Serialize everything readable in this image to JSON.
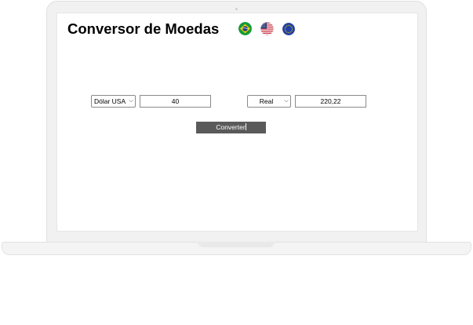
{
  "app": {
    "title": "Conversor de Moedas"
  },
  "flags": [
    {
      "name": "brazil-flag-icon",
      "country": "Brasil"
    },
    {
      "name": "usa-flag-icon",
      "country": "USA"
    },
    {
      "name": "eu-flag-icon",
      "country": "Euro"
    }
  ],
  "from": {
    "currency": "Dólar USA",
    "amount": "40"
  },
  "to": {
    "currency": "Real",
    "amount": "220,22"
  },
  "actions": {
    "convert_label": "Converter"
  },
  "colors": {
    "button_bg": "#5a5a5a",
    "brazil_green": "#139a3b",
    "brazil_yellow": "#f3d000",
    "brazil_blue": "#1e3f8f",
    "usa_red": "#c8283a",
    "usa_blue": "#2b3e7a",
    "eu_blue": "#1f3fa6",
    "eu_gold": "#f5cc00"
  }
}
